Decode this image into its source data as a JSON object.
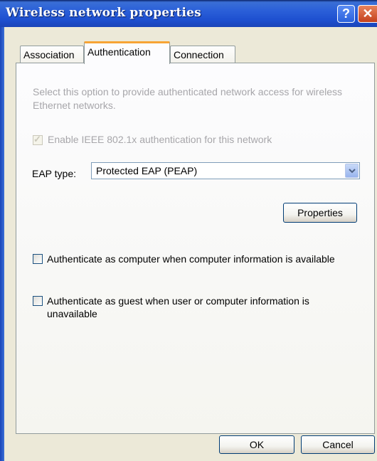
{
  "window": {
    "title": "Wireless network properties",
    "help_symbol": "?",
    "close_symbol": "✕"
  },
  "tabs": [
    {
      "label": "Association",
      "active": false
    },
    {
      "label": "Authentication",
      "active": true
    },
    {
      "label": "Connection",
      "active": false
    }
  ],
  "authentication": {
    "description": "Select this option to provide authenticated network access for wireless Ethernet networks.",
    "enable_8021x": {
      "label": "Enable IEEE 802.1x authentication for this network",
      "checked": true,
      "enabled": false
    },
    "eap_type_label": "EAP type:",
    "eap_type_value": "Protected EAP (PEAP)",
    "properties_label": "Properties",
    "auth_as_computer": {
      "label": "Authenticate as computer when computer information is available",
      "checked": false
    },
    "auth_as_guest": {
      "label": "Authenticate as guest when user or computer information is unavailable",
      "checked": false
    }
  },
  "footer": {
    "ok_label": "OK",
    "cancel_label": "Cancel"
  },
  "colors": {
    "titlebar": "#2a5fd8",
    "active_tab_accent": "#f7a435",
    "dialog_background": "#ece9d8",
    "disabled_text": "#a7a6aa"
  }
}
